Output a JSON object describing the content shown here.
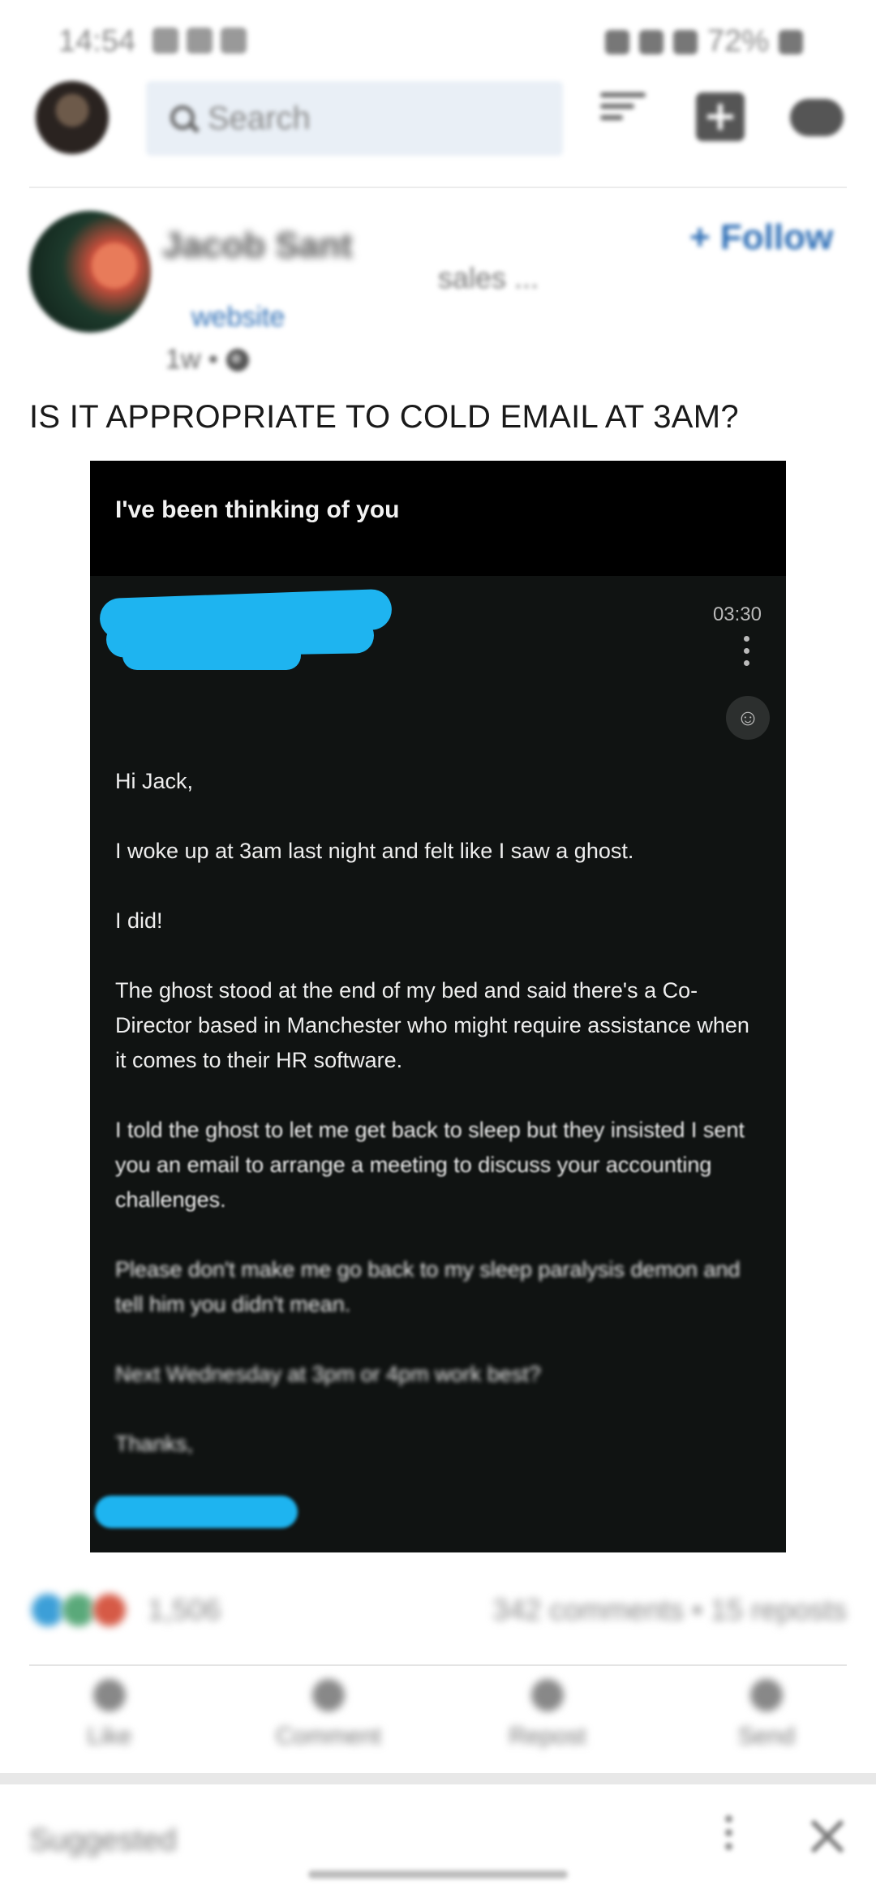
{
  "status_bar": {
    "time": "14:54",
    "battery": "72%"
  },
  "app_bar": {
    "search_placeholder": "Search"
  },
  "post": {
    "author": {
      "name": "Jacob Sant",
      "headline": "sales ...",
      "link_text": "website"
    },
    "follow_label": "+ Follow",
    "age": "1w •",
    "text": "IS IT APPROPRIATE TO COLD EMAIL AT 3AM?",
    "embedded_email": {
      "subject": "I've been thinking of you",
      "time": "03:30",
      "body": [
        "Hi Jack,",
        "I woke up at 3am last night and felt like I saw a ghost.",
        "I did!",
        "The ghost stood at the end of my bed and said there's a Co-Director based in Manchester who might require assistance when it comes to their HR software.",
        "I told the ghost to let me get back to sleep but they insisted I sent you an email to arrange a meeting to discuss your accounting challenges.",
        "Please don't make me go back to my sleep paralysis demon and tell him you didn't mean.",
        "Next Wednesday at 3pm or 4pm work best?",
        "Thanks,"
      ]
    },
    "reaction_count": "1,506",
    "engagement": "342 comments • 15 reposts",
    "actions": [
      {
        "label": "Like",
        "icon": "thumbs-up-icon"
      },
      {
        "label": "Comment",
        "icon": "comment-icon"
      },
      {
        "label": "Repost",
        "icon": "repost-icon"
      },
      {
        "label": "Send",
        "icon": "send-icon"
      }
    ]
  },
  "suggested_label": "Suggested",
  "colors": {
    "redaction": "#1eb4f0",
    "link": "#2f6fb6",
    "email_bg": "#101312"
  }
}
